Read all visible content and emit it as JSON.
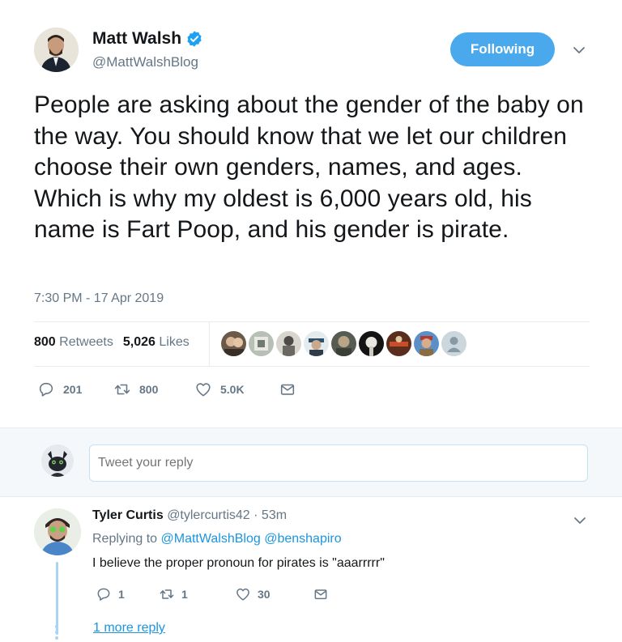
{
  "author": {
    "name": "Matt Walsh",
    "handle": "@MattWalshBlog",
    "follow_label": "Following"
  },
  "tweet": {
    "text": "People are asking about the gender of the baby on the way. You should know that we let our children choose their own genders, names, and ages. Which is why my oldest is 6,000 years old, his name is Fart Poop, and his gender is pirate.",
    "timestamp": "7:30 PM - 17 Apr 2019",
    "retweets_count": "800",
    "retweets_label": "Retweets",
    "likes_count": "5,026",
    "likes_label": "Likes"
  },
  "actions": {
    "replies": "201",
    "retweets": "800",
    "likes": "5.0K"
  },
  "reply_box": {
    "placeholder": "Tweet your reply"
  },
  "reply": {
    "name": "Tyler Curtis",
    "handle": "@tylercurtis42",
    "time": "· 53m",
    "replying_prefix": "Replying to",
    "replying_to_1": "@MattWalshBlog",
    "replying_to_2": "@benshapiro",
    "text": "I believe the proper pronoun for pirates is \"aaarrrrr\"",
    "replies": "1",
    "retweets": "1",
    "likes": "30",
    "more_replies": "1 more reply"
  },
  "colors": {
    "accent": "#1b95e0",
    "follow_button": "#4aa8ec",
    "secondary_text": "#657786",
    "thread_line": "#a8d4f5"
  }
}
